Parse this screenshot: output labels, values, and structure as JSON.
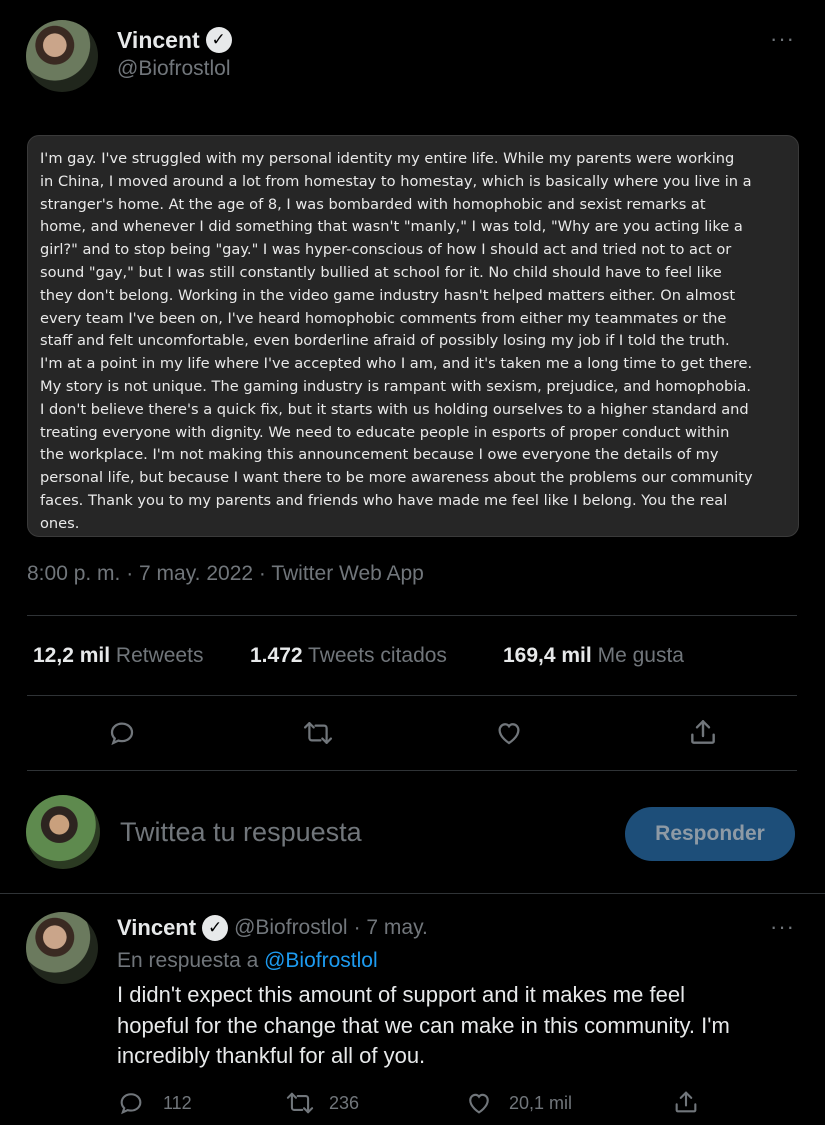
{
  "tweet": {
    "author_name": "Vincent",
    "author_handle": "@Biofrostlol",
    "more_icon": "more-dots-icon",
    "verified_icon": "verified-badge-icon",
    "statement": "I'm gay. I've struggled with my personal identity my entire life. While my parents were working in China, I moved around a lot from homestay to homestay, which is basically where you live in a stranger's home. At the age of 8, I was bombarded with homophobic and sexist remarks at home, and whenever I did something that wasn't \"manly,\" I was told, \"Why are you acting like a girl?\" and to stop being \"gay.\" I was hyper-conscious of how I should act and tried not to act or sound \"gay,\" but I was still constantly bullied at school for it. No child should have to feel like they don't belong. Working in the video game industry hasn't helped matters either. On almost every team I've been on, I've heard homophobic comments from either my teammates or the staff and felt uncomfortable, even borderline afraid of possibly losing my job if I told the truth. I'm at a point in my life where I've accepted who I am, and it's taken me a long time to get there. My story is not unique. The gaming industry is rampant with sexism, prejudice, and homophobia. I don't believe there's a quick fix, but it starts with us holding ourselves to a higher standard and treating everyone with dignity. We need to educate people in esports of proper conduct within the workplace. I'm not making this announcement because I owe everyone the details of my personal life, but because I want there to be more awareness about the problems our community faces. Thank you to my parents and friends who have made me feel like I belong. You the real ones.",
    "statement_lines": [
      "I'm gay. I've struggled with my personal identity my entire life. While my parents were working",
      "in China, I moved around a lot from homestay to homestay, which is basically where you live in a",
      "stranger's home. At the age of 8, I was bombarded with homophobic and sexist remarks at",
      "home, and whenever I did something that wasn't \"manly,\" I was told, \"Why are you acting like a",
      "girl?\" and to stop being \"gay.\" I was hyper-conscious of how I should act and tried not to act or",
      "sound \"gay,\" but I was still constantly bullied at school for it. No child should have to feel like",
      "they don't belong. Working in the video game industry hasn't helped matters either. On almost",
      "every team I've been on, I've heard homophobic comments from either my teammates or the",
      "staff and felt uncomfortable, even borderline afraid of possibly losing my job if I told the truth.",
      "I'm at a point in my life where I've accepted who I am, and it's taken me a long time to get there.",
      "My story is not unique. The gaming industry is rampant with sexism, prejudice, and homophobia.",
      "I don't believe there's a quick fix, but it starts with us holding ourselves to a higher standard and",
      "treating everyone with dignity. We need to educate people in esports of proper conduct within",
      "the workplace. I'm not making this announcement because I owe everyone the details of my",
      "personal life, but because I want there to be more awareness about the problems our community",
      "faces. Thank you to my parents and friends who have made me feel like I belong. You the real",
      "ones."
    ],
    "timestamp": "8:00 p. m. · 7 may. 2022 · Twitter Web App",
    "stats": {
      "retweets_count": "12,2 mil",
      "retweets_label": "Retweets",
      "quotes_count": "1.472",
      "quotes_label": "Tweets citados",
      "likes_count": "169,4 mil",
      "likes_label": "Me gusta"
    },
    "actions": [
      "reply-icon",
      "retweet-icon",
      "like-icon",
      "share-icon"
    ]
  },
  "compose": {
    "placeholder": "Twittea tu respuesta",
    "button_label": "Responder"
  },
  "reply": {
    "author_name": "Vincent",
    "author_handle": "@Biofrostlol",
    "date": "· 7 may.",
    "replying_prefix": "En respuesta a",
    "replying_to": "@Biofrostlol",
    "text_lines": [
      "I didn't expect this amount of support and it makes me feel",
      "hopeful for the change that we can make in this community. I'm",
      "incredibly thankful for all of you."
    ],
    "reply_count": "112",
    "retweet_count": "236",
    "like_count": "20,1 mil"
  },
  "colors": {
    "background": "#000000",
    "text": "#e7e9ea",
    "muted": "#71767b",
    "link": "#1d9bf0",
    "button": "#1d4e79"
  }
}
